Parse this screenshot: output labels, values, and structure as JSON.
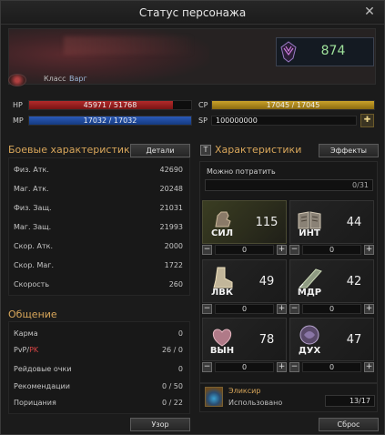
{
  "window": {
    "title": "Статус персонажа"
  },
  "character": {
    "class_label": "Класс",
    "class_value": "Варг",
    "combat_power": "874"
  },
  "bars": {
    "hp": {
      "label": "HP",
      "text": "45971 / 51768",
      "fill": 0.888
    },
    "mp": {
      "label": "MP",
      "text": "17032 / 17032",
      "fill": 1.0
    },
    "cp": {
      "label": "CP",
      "text": "17045 / 17045",
      "fill": 1.0
    },
    "sp": {
      "label": "SP",
      "text": "100000000"
    }
  },
  "combat": {
    "title": "Боевые характеристики",
    "details_button": "Детали",
    "rows": [
      {
        "k": "Физ. Атк.",
        "v": "42690"
      },
      {
        "k": "Маг. Атк.",
        "v": "20248"
      },
      {
        "k": "Физ. Защ.",
        "v": "21031"
      },
      {
        "k": "Маг. Защ.",
        "v": "21993"
      },
      {
        "k": "Скор. Атк.",
        "v": "2000"
      },
      {
        "k": "Скор. Маг.",
        "v": "1722"
      },
      {
        "k": "Скорость",
        "v": "260"
      }
    ]
  },
  "social": {
    "title": "Общение",
    "rows": [
      {
        "k": "Карма",
        "v": "0"
      },
      {
        "k_a": "PvP/",
        "k_b": "PK",
        "v": "26 / 0"
      },
      {
        "k": "Рейдовые очки",
        "v": "0"
      },
      {
        "k": "Рекомендации",
        "v": "0 / 50"
      },
      {
        "k": "Порицания",
        "v": "0 / 22"
      }
    ],
    "pattern_button": "Узор"
  },
  "attributes": {
    "title": "Характеристики",
    "effects_button": "Эффекты",
    "spend_label": "Можно потратить",
    "spend_value": "0/31",
    "cells": [
      {
        "abbr": "СИЛ",
        "value": "115",
        "step": "0",
        "icon": "fist-icon"
      },
      {
        "abbr": "ИНТ",
        "value": "44",
        "step": "0",
        "icon": "book-icon"
      },
      {
        "abbr": "ЛВК",
        "value": "49",
        "step": "0",
        "icon": "boot-icon"
      },
      {
        "abbr": "МДР",
        "value": "42",
        "step": "0",
        "icon": "quill-icon"
      },
      {
        "abbr": "ВЫН",
        "value": "78",
        "step": "0",
        "icon": "heart-icon"
      },
      {
        "abbr": "ДУХ",
        "value": "47",
        "step": "0",
        "icon": "spirit-icon"
      }
    ],
    "reset_button": "Сброс"
  },
  "elixir": {
    "name": "Эликсир",
    "used_label": "Использовано",
    "count": "13/17"
  },
  "colors": {
    "accent": "#d8a65a",
    "hp": "#b32a2a",
    "mp": "#2a5ab8",
    "cp": "#c9a22a",
    "score": "#9fe29b",
    "pk": "#d84545"
  }
}
